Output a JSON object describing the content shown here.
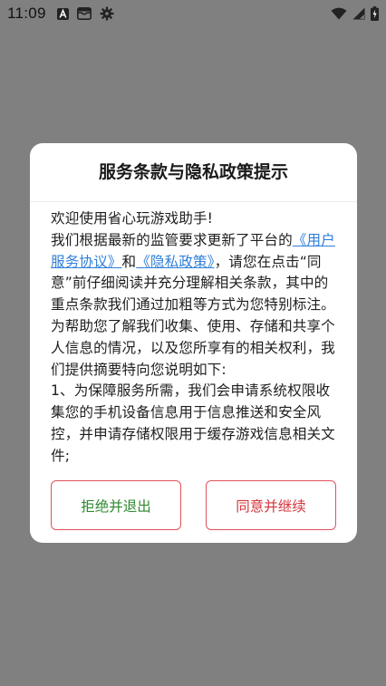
{
  "status_bar": {
    "time": "11:09",
    "left_icons": [
      "text-a-icon",
      "inbox-icon",
      "settings-gear-icon"
    ],
    "right_icons": [
      "wifi-icon",
      "cellular-signal-icon",
      "battery-icon"
    ]
  },
  "dialog": {
    "title": "服务条款与隐私政策提示",
    "body": {
      "p1": "欢迎使用省心玩游戏助手!",
      "p2_pre": "我们根据最新的监管要求更新了平台的",
      "link_user_agreement": "《用户服务协议》",
      "p2_and": "和",
      "link_privacy": "《隐私政策》",
      "p2_post": "，请您在点击“同意”前仔细阅读并充分理解相关条款，其中的重点条款我们通过加粗等方式为您特别标注。为帮助您了解我们收集、使用、存储和共享个人信息的情况，以及您所享有的相关权利，我们提供摘要特向您说明如下:",
      "p3": "1、为保障服务所需，我们会申请系统权限收集您的手机设备信息用于信息推送和安全风控，并申请存储权限用于缓存游戏信息相关文件;"
    },
    "buttons": {
      "reject": "拒绝并退出",
      "agree": "同意并继续"
    }
  },
  "colors": {
    "overlay": "#808080",
    "link": "#2f7fd8",
    "button_border": "#e0535b",
    "reject_text": "#2e8a2e",
    "agree_text": "#d6343c"
  }
}
